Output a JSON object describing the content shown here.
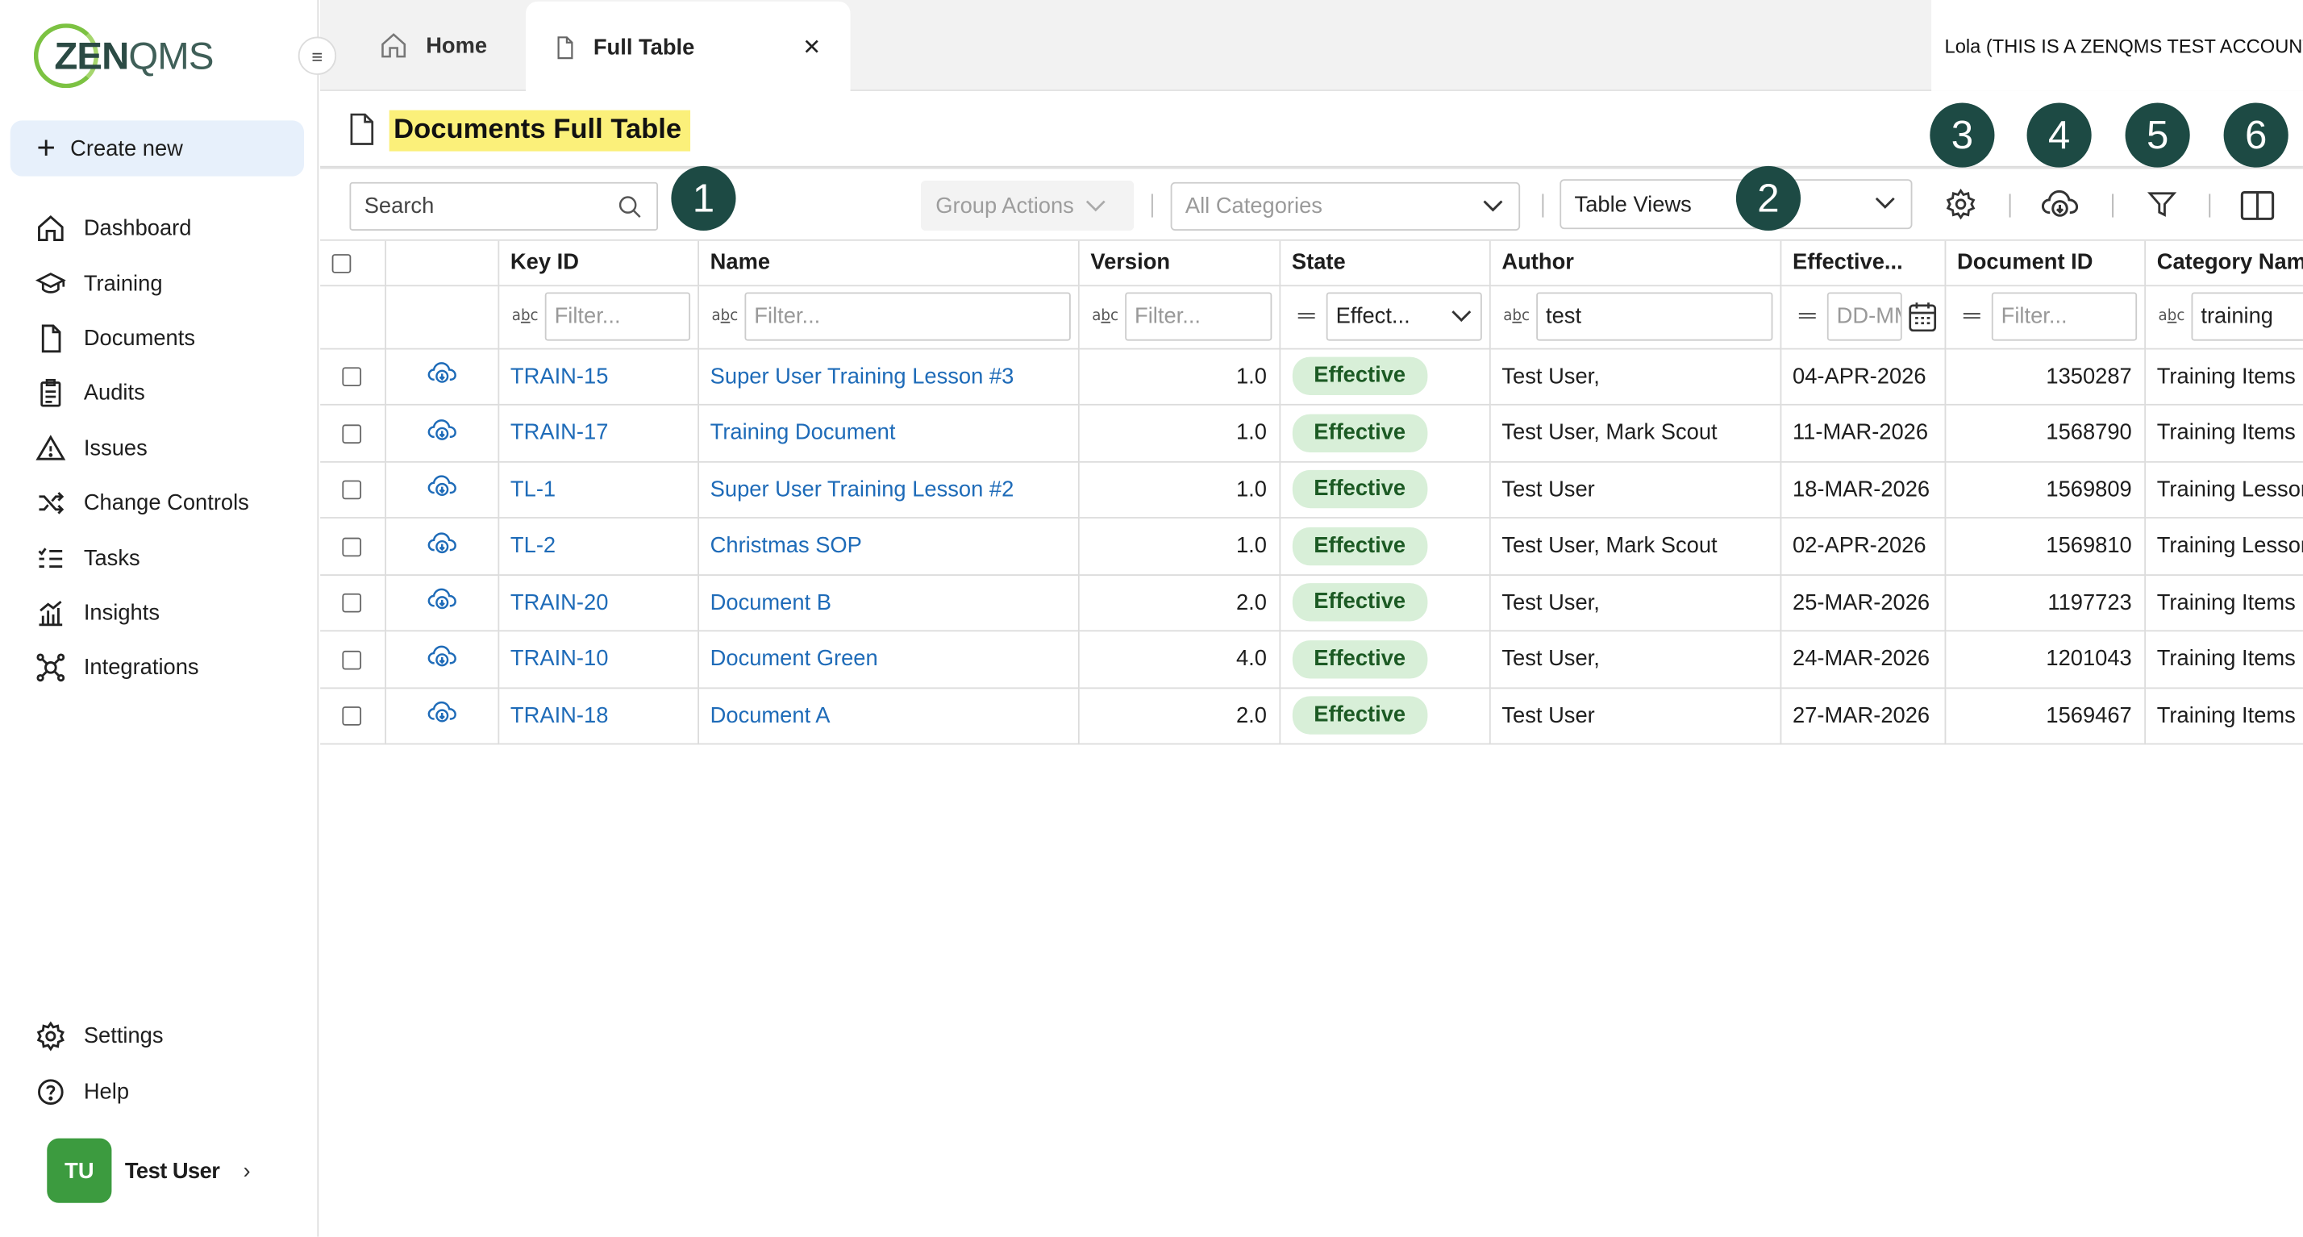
{
  "app": {
    "logo_bold": "ZEN",
    "logo_light": "QMS",
    "create_new": "Create new",
    "collapse_glyph": "≡"
  },
  "sidebar": {
    "items": [
      {
        "label": "Dashboard",
        "icon": "home-icon"
      },
      {
        "label": "Training",
        "icon": "graduation-cap-icon"
      },
      {
        "label": "Documents",
        "icon": "document-icon"
      },
      {
        "label": "Audits",
        "icon": "clipboard-icon"
      },
      {
        "label": "Issues",
        "icon": "warning-icon"
      },
      {
        "label": "Change Controls",
        "icon": "shuffle-icon"
      },
      {
        "label": "Tasks",
        "icon": "checklist-icon"
      },
      {
        "label": "Insights",
        "icon": "chart-icon"
      },
      {
        "label": "Integrations",
        "icon": "integrations-icon"
      }
    ],
    "bottom": [
      {
        "label": "Settings",
        "icon": "gear-icon"
      },
      {
        "label": "Help",
        "icon": "help-icon"
      }
    ],
    "user": {
      "initials": "TU",
      "name": "Test User"
    }
  },
  "tabs": {
    "home": "Home",
    "full_table": "Full Table",
    "close_glyph": "✕"
  },
  "account": "Lola (THIS IS A ZENQMS TEST ACCOUNT)",
  "page": {
    "title": "Documents Full Table"
  },
  "badges": [
    "1",
    "2",
    "3",
    "4",
    "5",
    "6"
  ],
  "toolbar": {
    "search_placeholder": "Search",
    "group_actions": "Group Actions",
    "categories_placeholder": "All Categories",
    "table_views": "Table Views"
  },
  "table": {
    "headers": [
      "Key ID",
      "Name",
      "Version",
      "State",
      "Author",
      "Effective...",
      "Document ID",
      "Category Name"
    ],
    "filters": {
      "key_id": "Filter...",
      "name": "Filter...",
      "version": "Filter...",
      "state": "Effect...",
      "author": "test",
      "effective": "DD-MMM-YYYY",
      "document_id": "Filter...",
      "category": "training"
    },
    "rows": [
      {
        "key": "TRAIN-15",
        "name": "Super User Training Lesson #3",
        "version": "1.0",
        "state": "Effective",
        "author": "Test User,",
        "effective": "04-APR-2026",
        "doc_id": "1350287",
        "category": "Training Items"
      },
      {
        "key": "TRAIN-17",
        "name": "Training Document",
        "version": "1.0",
        "state": "Effective",
        "author": "Test User, Mark Scout",
        "effective": "11-MAR-2026",
        "doc_id": "1568790",
        "category": "Training Items"
      },
      {
        "key": "TL-1",
        "name": "Super User Training Lesson #2",
        "version": "1.0",
        "state": "Effective",
        "author": "Test User",
        "effective": "18-MAR-2026",
        "doc_id": "1569809",
        "category": "Training Lessons"
      },
      {
        "key": "TL-2",
        "name": "Christmas SOP",
        "version": "1.0",
        "state": "Effective",
        "author": "Test User, Mark Scout",
        "effective": "02-APR-2026",
        "doc_id": "1569810",
        "category": "Training Lessons"
      },
      {
        "key": "TRAIN-20",
        "name": "Document B",
        "version": "2.0",
        "state": "Effective",
        "author": "Test User,",
        "effective": "25-MAR-2026",
        "doc_id": "1197723",
        "category": "Training Items"
      },
      {
        "key": "TRAIN-10",
        "name": "Document Green",
        "version": "4.0",
        "state": "Effective",
        "author": "Test User,",
        "effective": "24-MAR-2026",
        "doc_id": "1201043",
        "category": "Training Items"
      },
      {
        "key": "TRAIN-18",
        "name": "Document A",
        "version": "2.0",
        "state": "Effective",
        "author": "Test User",
        "effective": "27-MAR-2026",
        "doc_id": "1569467",
        "category": "Training Items"
      }
    ]
  },
  "colors": {
    "accent": "#1d4a44",
    "link": "#1e6bb8",
    "highlight": "#fbf07a",
    "state_pill": "#d8efd8",
    "create_bg": "#e7f0fb",
    "avatar": "#3c9b3f"
  }
}
